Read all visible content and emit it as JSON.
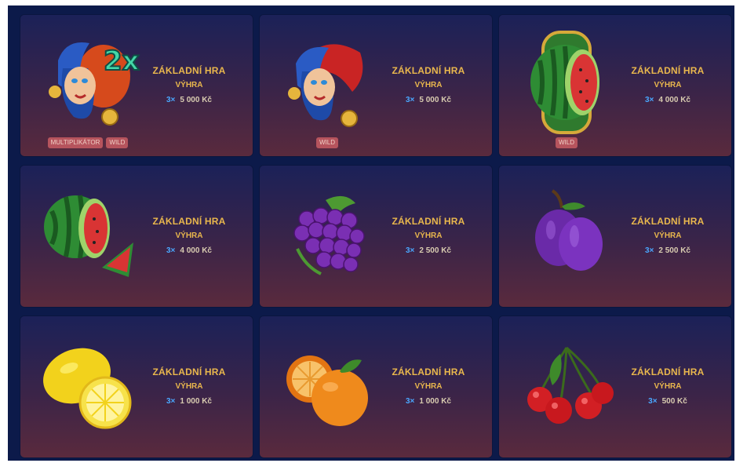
{
  "symbols": [
    {
      "icon": "joker-2x-icon",
      "mode": "ZÁKLADNÍ HRA",
      "win_label": "VÝHRA",
      "count": "3×",
      "amount": "5 000 Kč",
      "badges": [
        "MULTIPLIKÁTOR",
        "WILD"
      ]
    },
    {
      "icon": "joker-icon",
      "mode": "ZÁKLADNÍ HRA",
      "win_label": "VÝHRA",
      "count": "3×",
      "amount": "5 000 Kč",
      "badges": [
        "WILD"
      ]
    },
    {
      "icon": "framed-watermelon-icon",
      "mode": "ZÁKLADNÍ HRA",
      "win_label": "VÝHRA",
      "count": "3×",
      "amount": "4 000 Kč",
      "badges": [
        "WILD"
      ]
    },
    {
      "icon": "watermelon-icon",
      "mode": "ZÁKLADNÍ HRA",
      "win_label": "VÝHRA",
      "count": "3×",
      "amount": "4 000 Kč",
      "badges": []
    },
    {
      "icon": "grapes-icon",
      "mode": "ZÁKLADNÍ HRA",
      "win_label": "VÝHRA",
      "count": "3×",
      "amount": "2 500 Kč",
      "badges": []
    },
    {
      "icon": "plum-icon",
      "mode": "ZÁKLADNÍ HRA",
      "win_label": "VÝHRA",
      "count": "3×",
      "amount": "2 500 Kč",
      "badges": []
    },
    {
      "icon": "lemon-icon",
      "mode": "ZÁKLADNÍ HRA",
      "win_label": "VÝHRA",
      "count": "3×",
      "amount": "1 000 Kč",
      "badges": []
    },
    {
      "icon": "orange-icon",
      "mode": "ZÁKLADNÍ HRA",
      "win_label": "VÝHRA",
      "count": "3×",
      "amount": "1 000 Kč",
      "badges": []
    },
    {
      "icon": "cherries-icon",
      "mode": "ZÁKLADNÍ HRA",
      "win_label": "VÝHRA",
      "count": "3×",
      "amount": "500 Kč",
      "badges": []
    }
  ],
  "colors": {
    "background": "#0c1a4a",
    "card_top": "#1b2158",
    "card_bottom": "#5a2a3d",
    "gold_text": "#e9b74d",
    "count_blue": "#4aa8ff",
    "badge": "#b6545d"
  }
}
